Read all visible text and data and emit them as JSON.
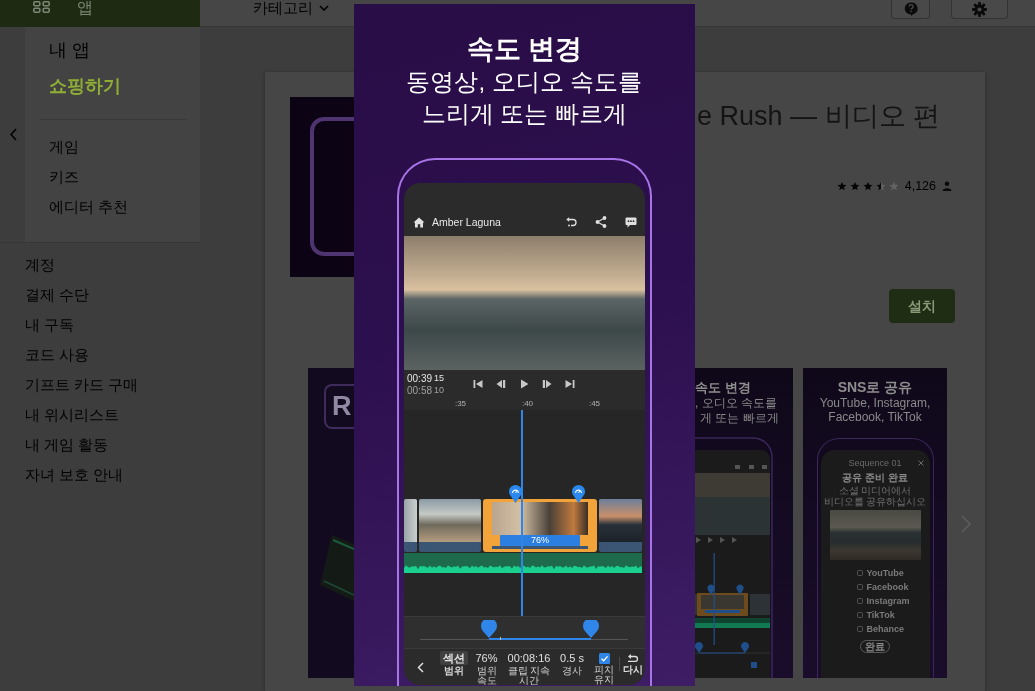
{
  "header": {
    "apps_tab": "앱",
    "category_menu": "카테고리"
  },
  "sidebar": {
    "top_links": [
      {
        "label": "내 앱",
        "selected": false
      },
      {
        "label": "쇼핑하기",
        "selected": true
      }
    ],
    "categories": [
      "게임",
      "키즈",
      "에디터 추천"
    ],
    "account_links": [
      "계정",
      "결제 수단",
      "내 구독",
      "코드 사용",
      "기프트 카드 구매",
      "내 위시리스트",
      "내 게임 활동",
      "자녀 보호 안내"
    ]
  },
  "app": {
    "title": "e Rush — 비디오 편",
    "stars": 3.5,
    "rating_count": "4,126",
    "install_button": "설치"
  },
  "screenshots": [
    {
      "kind": "logo",
      "logo_text": "R"
    },
    {
      "kind": "speed",
      "title": "속도 변경",
      "lines": [
        ", 오디오 속도를",
        "게 또는 빠르게"
      ]
    },
    {
      "kind": "share",
      "title": "SNS로 공유",
      "subtitle": "YouTube, Instagram, Facebook, TikTok",
      "dialog": {
        "sequence": "Sequence 01",
        "heading": "공유 준비 완료",
        "subheading": "소셜 미디어에서 비디오를 공유하십시오",
        "platforms": [
          "YouTube",
          "Facebook",
          "Instagram",
          "TikTok",
          "Behance"
        ],
        "done_button": "완료"
      }
    }
  ],
  "viewer": {
    "title": "속도 변경",
    "subtitle": "동영상, 오디오 속도를 느리게 또는 빠르게",
    "phone": {
      "project_name": "Amber Laguna",
      "current_time": "00:39",
      "current_frames": "15",
      "total_time": "00:58",
      "total_frames": "10",
      "ruler": [
        ":35",
        ":40",
        ":45"
      ],
      "clips": [
        {
          "selected": false
        },
        {
          "selected": false
        },
        {
          "selected": true,
          "speed": "76%"
        },
        {
          "selected": false
        }
      ],
      "range": {
        "start": {
          "level": 0.33
        },
        "end": {
          "level": 0.82
        }
      },
      "controls": [
        {
          "kind": "chip",
          "value": "섹션",
          "label": "범위"
        },
        {
          "kind": "value",
          "value": "76%",
          "label": "범위 속도"
        },
        {
          "kind": "value",
          "value": "00:08:16",
          "label": "클립 지속 시간"
        },
        {
          "kind": "value",
          "value": "0.5 s",
          "label": "경사"
        },
        {
          "kind": "checkbox",
          "checked": true,
          "label": "피치 유지"
        },
        {
          "kind": "undo",
          "label": "다시"
        }
      ]
    }
  }
}
